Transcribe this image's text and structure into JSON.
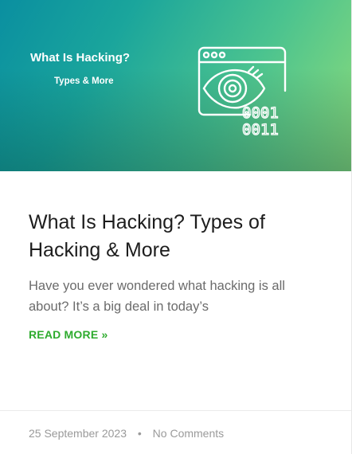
{
  "hero": {
    "title": "What Is Hacking?",
    "subtitle": "Types & More",
    "icon": "hacking-eye-binary-icon",
    "binary_top": "0001",
    "binary_bottom": "0011",
    "colors": {
      "gradient_start": "#0a8fa0",
      "gradient_end": "#8edc7a"
    }
  },
  "post": {
    "title": "What Is Hacking? Types of Hacking & More",
    "excerpt": "Have you ever wondered what hacking is all about? It’s a big deal in today’s",
    "read_more": "READ MORE »",
    "read_more_color": "#2eab2e"
  },
  "meta": {
    "date": "25 September 2023",
    "separator": "•",
    "comments": "No Comments"
  }
}
